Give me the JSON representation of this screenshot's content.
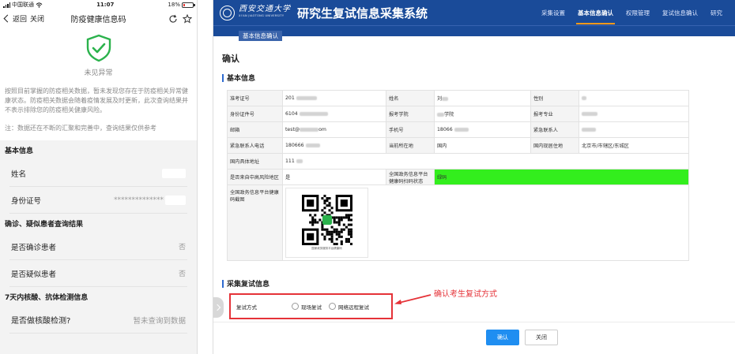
{
  "phone": {
    "status_bar": {
      "carrier": "中国联通",
      "time": "11:07",
      "battery": "18%",
      "battery_level": 0.18
    },
    "nav": {
      "back": "返回",
      "close": "关闭",
      "title": "防疫健康信息码"
    },
    "status": {
      "text": "未见异常"
    },
    "notice": "按照目前掌握的防疫相关数据，暂未发现您存在于防疫相关异常健康状态。防疫相关数据会随着疫情发展及时更新，此次查询结果并不表示排除您的防疫相关健康风险。",
    "note": "注：数据还在不断的汇聚和完善中，查询结果仅供参考",
    "basic_info": {
      "title": "基本信息",
      "rows": [
        {
          "label": "姓名",
          "value": "",
          "masked": true
        },
        {
          "label": "身份证号",
          "value": "**************",
          "masked": true
        }
      ]
    },
    "diagnosis": {
      "title": "确诊、疑似患者查询结果",
      "rows": [
        {
          "label": "是否确诊患者",
          "value": "否"
        },
        {
          "label": "是否疑似患者",
          "value": "否"
        }
      ]
    },
    "tests": {
      "title": "7天内核酸、抗体检测信息",
      "rows": [
        {
          "label": "是否做核酸检测?",
          "value": "暂未查询到数据"
        }
      ]
    }
  },
  "web": {
    "header": {
      "university_logo_text": "西安交通大学",
      "university_logo_en": "XI'AN JIAOTONG UNIVERSITY",
      "system_title": "研究生复试信息采集系统",
      "menu": [
        {
          "label": "采集设置",
          "active": false
        },
        {
          "label": "基本信息确认",
          "active": true
        },
        {
          "label": "权限管理",
          "active": false
        },
        {
          "label": "复试信息确认",
          "active": false
        },
        {
          "label": "研究",
          "active": false
        }
      ]
    },
    "breadcrumb": "基本信息确认",
    "page_title": "确认",
    "basic_section": {
      "title": "基本信息"
    },
    "info_table": {
      "exam_id_label": "准考证号",
      "exam_id_value": "201",
      "name_label": "姓名",
      "name_value": "刘",
      "gender_label": "性别",
      "id_label": "身份证件号",
      "id_value": "6104",
      "college_label": "报考学院",
      "college_value": "学院",
      "major_label": "报考专业",
      "email_label": "邮箱",
      "email_prefix": "test@",
      "email_suffix": "om",
      "phone_label": "手机号",
      "phone_value": "18066",
      "emergency_contact_label": "紧急联系人",
      "emergency_phone_label": "紧急联系人电话",
      "emergency_phone_value": "180666",
      "current_location_label": "当前所在地",
      "current_location_value": "国内",
      "residence_label": "国内现居住地",
      "residence_value": "北京市/市辖区/东城区",
      "address_label": "国内具体地址",
      "address_value": "111",
      "risk_area_label": "是否来自中高风险地区",
      "risk_area_value": "是",
      "health_code_status_label": "全国政务信息平台健康码扫码状态",
      "health_code_status_value": "绿码",
      "health_code_image_label": "全国政务信息平台健康码截图",
      "qr_caption": "国家政务服务平台健康码"
    },
    "retest_section": {
      "title": "采集复试信息",
      "field_label": "复试方式",
      "options": [
        {
          "label": "现场复试",
          "selected": false
        },
        {
          "label": "网络远程复试",
          "selected": false
        }
      ],
      "annotation": "确认考生复试方式"
    },
    "buttons": {
      "confirm": "确认",
      "close": "关闭"
    },
    "colors": {
      "header_bg": "#1a4b99",
      "active_underline": "#ff9a1a",
      "green_code": "#33ee1d",
      "annotation_red": "#e53238",
      "confirm_blue": "#1f8ef1"
    }
  }
}
